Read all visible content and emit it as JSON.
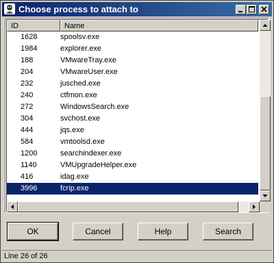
{
  "window": {
    "title": "Choose process to attach to"
  },
  "columns": {
    "id": "ID",
    "name": "Name"
  },
  "processes": [
    {
      "id": "1628",
      "name": "spoolsv.exe"
    },
    {
      "id": "1984",
      "name": "explorer.exe"
    },
    {
      "id": "188",
      "name": "VMwareTray.exe"
    },
    {
      "id": "204",
      "name": "VMwareUser.exe"
    },
    {
      "id": "232",
      "name": "jusched.exe"
    },
    {
      "id": "240",
      "name": "ctfmon.exe"
    },
    {
      "id": "272",
      "name": "WindowsSearch.exe"
    },
    {
      "id": "304",
      "name": "svchost.exe"
    },
    {
      "id": "444",
      "name": "jqs.exe"
    },
    {
      "id": "584",
      "name": "vmtoolsd.exe"
    },
    {
      "id": "1200",
      "name": "searchindexer.exe"
    },
    {
      "id": "1140",
      "name": "VMUpgradeHelper.exe"
    },
    {
      "id": "416",
      "name": "idag.exe"
    },
    {
      "id": "3996",
      "name": "fcrip.exe",
      "selected": true
    }
  ],
  "buttons": {
    "ok": "OK",
    "cancel": "Cancel",
    "help": "Help",
    "search": "Search"
  },
  "status": "Line 26 of 26",
  "colors": {
    "title_bar": "#0a246a",
    "selection": "#0a246a",
    "face": "#d4d0c8"
  }
}
